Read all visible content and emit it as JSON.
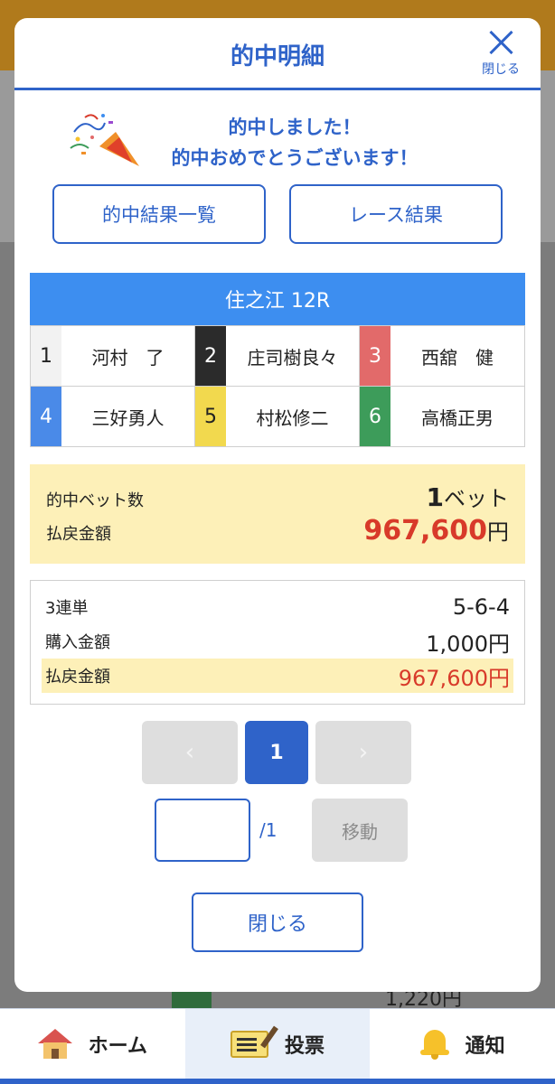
{
  "modal": {
    "title": "的中明細",
    "close_label": "閉じる",
    "congrats_line1": "的中しました！",
    "congrats_line2": "的中おめでとうございます！",
    "buttons": {
      "hit_list": "的中結果一覧",
      "race_result": "レース結果"
    }
  },
  "race": {
    "header": "住之江 12R",
    "racers": [
      {
        "lane": "1",
        "name": "河村　了",
        "lane_bg": "#f2f2f2",
        "lane_fg": "#222222"
      },
      {
        "lane": "2",
        "name": "庄司樹良々",
        "lane_bg": "#2b2b2b",
        "lane_fg": "#ffffff"
      },
      {
        "lane": "3",
        "name": "西舘　健",
        "lane_bg": "#e26a6a",
        "lane_fg": "#ffffff"
      },
      {
        "lane": "4",
        "name": "三好勇人",
        "lane_bg": "#4a8ae8",
        "lane_fg": "#ffffff"
      },
      {
        "lane": "5",
        "name": "村松修二",
        "lane_bg": "#f2d94e",
        "lane_fg": "#222222"
      },
      {
        "lane": "6",
        "name": "高橋正男",
        "lane_bg": "#3d9c5a",
        "lane_fg": "#ffffff"
      }
    ]
  },
  "summary": {
    "bet_count_label": "的中ベット数",
    "bet_count": "1",
    "bet_unit": "ベット",
    "payout_label": "払戻金額",
    "payout": "967,600",
    "yen": "円"
  },
  "ticket": {
    "type": "3連単",
    "combo": "5-6-4",
    "purchase_label": "購入金額",
    "purchase": "1,000円",
    "payout_label": "払戻金額",
    "payout": "967,600円"
  },
  "pager": {
    "prev": "‹",
    "current": "1",
    "next": "›",
    "total": "/1",
    "jump_label": "移動",
    "jump_value": ""
  },
  "close_bottom": "閉じる",
  "background": {
    "amount": "1,220円"
  },
  "nav": [
    {
      "label": "ホーム",
      "icon": "home-icon"
    },
    {
      "label": "投票",
      "icon": "ticket-icon"
    },
    {
      "label": "通知",
      "icon": "bell-icon"
    }
  ],
  "colors": {
    "accent": "#2f63c9",
    "race_header": "#3d8ef0",
    "highlight": "#fdf0b8",
    "payout_red": "#d83a2a"
  }
}
